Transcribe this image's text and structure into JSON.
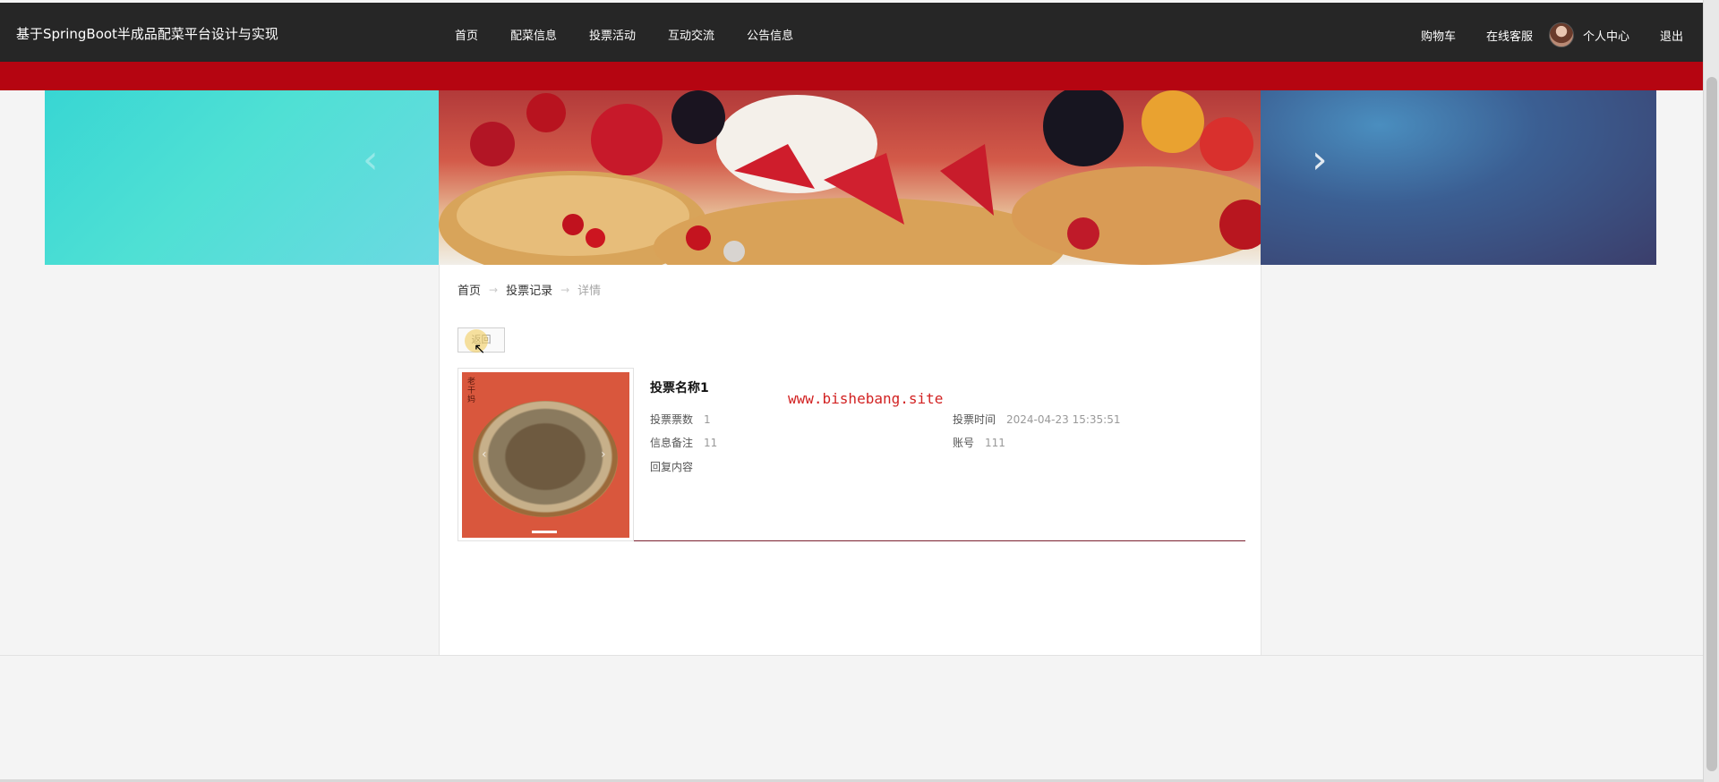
{
  "header": {
    "site_title": "基于SpringBoot半成品配菜平台设计与实现",
    "nav": [
      "首页",
      "配菜信息",
      "投票活动",
      "互动交流",
      "公告信息"
    ],
    "right": {
      "cart": "购物车",
      "service": "在线客服",
      "profile": "个人中心",
      "logout": "退出"
    }
  },
  "breadcrumb": {
    "home": "首页",
    "section": "投票记录",
    "current": "详情"
  },
  "back_button": "返回",
  "thumbnail_caption": "老干妈",
  "detail": {
    "name": "投票名称1",
    "votes_label": "投票票数",
    "votes_value": "1",
    "time_label": "投票时间",
    "time_value": "2024-04-23 15:35:51",
    "remark_label": "信息备注",
    "remark_value": "11",
    "account_label": "账号",
    "account_value": "111",
    "reply_label": "回复内容"
  },
  "watermark": "www.bishebang.site",
  "colors": {
    "topbar": "#262626",
    "accent_red": "#b50511",
    "divider": "#7a1f2e"
  },
  "icons": {
    "prev": "chevron-left-icon",
    "next": "chevron-right-icon",
    "cursor": "mouse-cursor-icon"
  }
}
